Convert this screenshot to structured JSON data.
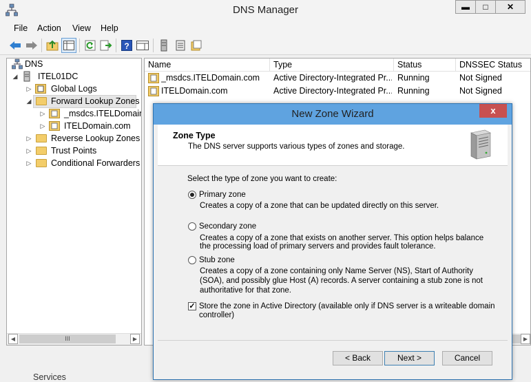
{
  "window": {
    "title": "DNS Manager"
  },
  "menu": [
    "File",
    "Action",
    "View",
    "Help"
  ],
  "window_buttons": {
    "minimize": "▬",
    "restore": "□",
    "close": "✕"
  },
  "tree": {
    "items": [
      {
        "label": "DNS",
        "level": 0,
        "expander": ""
      },
      {
        "label": "ITEL01DC",
        "level": 1,
        "expander": "◢"
      },
      {
        "label": "Global Logs",
        "level": 2,
        "expander": "▷"
      },
      {
        "label": "Forward Lookup Zones",
        "level": 2,
        "expander": "◢"
      },
      {
        "label": "_msdcs.ITELDomain.c",
        "level": 3,
        "expander": "▷"
      },
      {
        "label": "ITELDomain.com",
        "level": 3,
        "expander": "▷"
      },
      {
        "label": "Reverse Lookup Zones",
        "level": 2,
        "expander": "▷"
      },
      {
        "label": "Trust Points",
        "level": 2,
        "expander": "▷"
      },
      {
        "label": "Conditional Forwarders",
        "level": 2,
        "expander": "▷"
      }
    ],
    "scroll_grip": "III"
  },
  "list": {
    "columns": [
      "Name",
      "Type",
      "Status",
      "DNSSEC Status"
    ],
    "rows": [
      {
        "name": "_msdcs.ITELDomain.com",
        "type": "Active Directory-Integrated Pr...",
        "status": "Running",
        "dnssec": "Not Signed"
      },
      {
        "name": "ITELDomain.com",
        "type": "Active Directory-Integrated Pr...",
        "status": "Running",
        "dnssec": "Not Signed"
      }
    ]
  },
  "status_bar": {
    "text": "Services"
  },
  "dialog": {
    "title": "New Zone Wizard",
    "close_label": "x",
    "heading": "Zone Type",
    "subheading": "The DNS server supports various types of zones and storage.",
    "prompt": "Select the type of zone you want to create:",
    "options": [
      {
        "label": "Primary zone",
        "selected": true,
        "description": "Creates a copy of a zone that can be updated directly on this server."
      },
      {
        "label": "Secondary zone",
        "selected": false,
        "description_1": "Creates a copy of a zone that exists on another server. This option helps balance",
        "description_2": "the processing load of primary servers and provides fault tolerance."
      },
      {
        "label": "Stub zone",
        "selected": false,
        "description_1": "Creates a copy of a zone containing only Name Server (NS), Start of Authority",
        "description_2": "(SOA), and possibly glue Host (A) records. A server containing a stub zone is not",
        "description_3": "authoritative for that zone."
      }
    ],
    "store_ad": {
      "checked": true,
      "check_mark": "✓",
      "line_1": "Store the zone in Active Directory (available only if DNS server is a writeable domain",
      "line_2": "controller)"
    },
    "buttons": {
      "back": "< Back",
      "next": "Next >",
      "cancel": "Cancel"
    }
  }
}
